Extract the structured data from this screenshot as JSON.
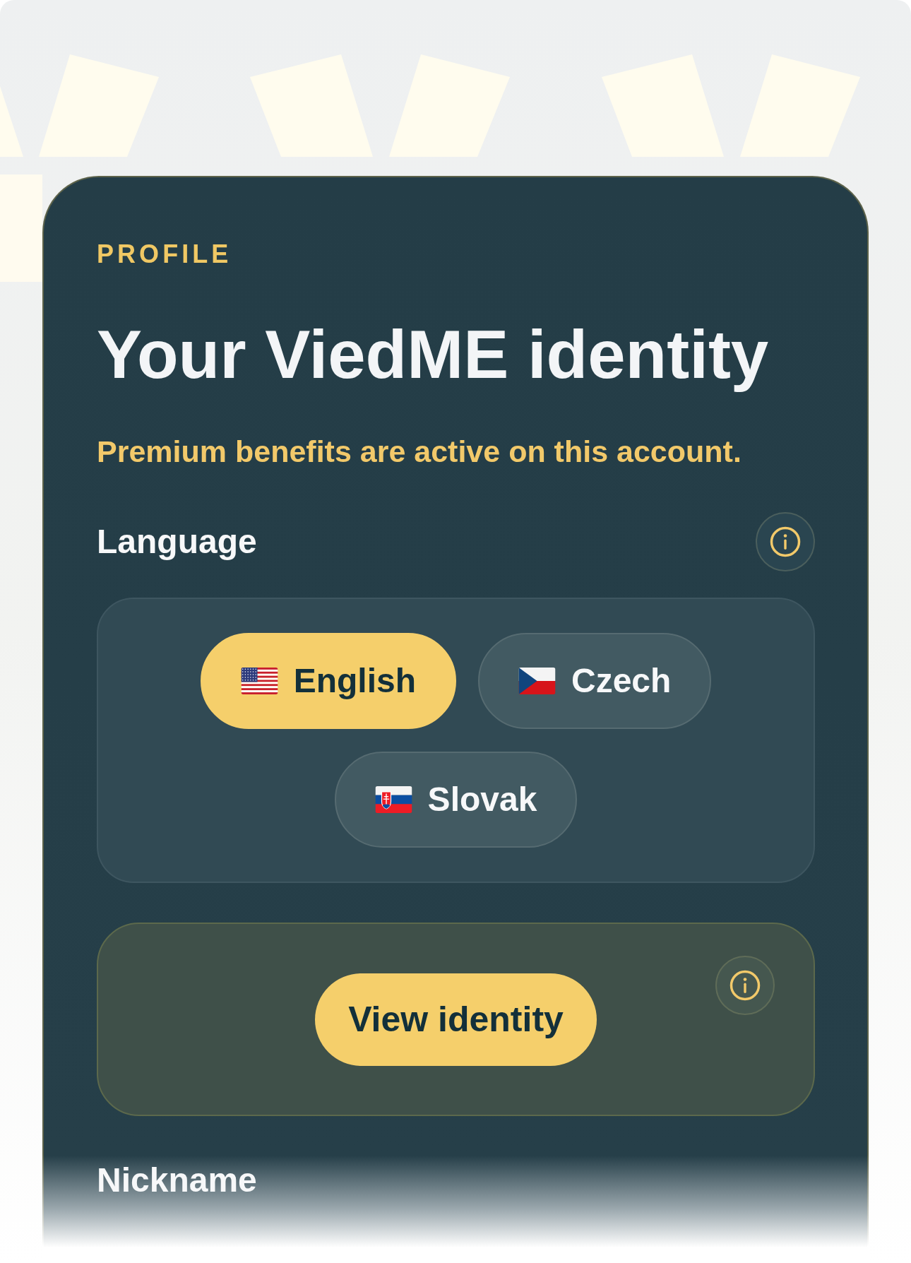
{
  "header": {
    "eyebrow": "PROFILE",
    "title": "Your ViedME identity",
    "status": "Premium benefits are active on this account."
  },
  "language": {
    "label": "Language",
    "options": [
      {
        "label": "English",
        "selected": true
      },
      {
        "label": "Czech",
        "selected": false
      },
      {
        "label": "Slovak",
        "selected": false
      }
    ]
  },
  "identity": {
    "button": "View identity"
  },
  "nickname": {
    "label": "Nickname"
  }
}
